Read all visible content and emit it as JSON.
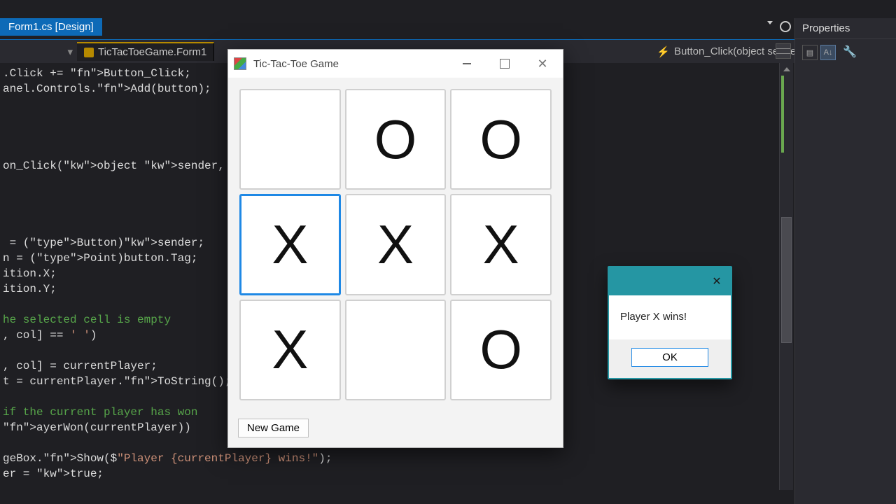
{
  "ide": {
    "active_tab": "Form1.cs [Design]",
    "file_tab": "TicTacToeGame.Form1",
    "method_selector": "Button_Click(object sender, EventArgs e)",
    "props_title": "Properties"
  },
  "code_lines": [
    {
      "t": ".Click += Button_Click;"
    },
    {
      "t": "anel.Controls.Add(button);"
    },
    {
      "t": ""
    },
    {
      "t": ""
    },
    {
      "t": ""
    },
    {
      "t": ""
    },
    {
      "t": "on_Click(object sender, EventArgs e"
    },
    {
      "t": ""
    },
    {
      "t": ""
    },
    {
      "t": ""
    },
    {
      "t": ""
    },
    {
      "t": " = (Button)sender;"
    },
    {
      "t": "n = (Point)button.Tag;"
    },
    {
      "t": "ition.X;"
    },
    {
      "t": "ition.Y;"
    },
    {
      "t": ""
    },
    {
      "t": "he selected cell is empty",
      "cls": "com"
    },
    {
      "t": ", col] == ' ')"
    },
    {
      "t": ""
    },
    {
      "t": ", col] = currentPlayer;"
    },
    {
      "t": "t = currentPlayer.ToString();"
    },
    {
      "t": ""
    },
    {
      "t": "if the current player has won",
      "cls": "com"
    },
    {
      "t": "ayerWon(currentPlayer))"
    },
    {
      "t": ""
    },
    {
      "t": "geBox.Show($\"Player {currentPlayer} wins!\");"
    },
    {
      "t": "er = true;"
    }
  ],
  "ttt": {
    "title": "Tic-Tac-Toe Game",
    "new_game_label": "New Game",
    "board": [
      "",
      "O",
      "O",
      "X",
      "X",
      "X",
      "X",
      "",
      "O"
    ],
    "focused_cell": 3
  },
  "msgbox": {
    "text": "Player X wins!",
    "ok_label": "OK"
  }
}
